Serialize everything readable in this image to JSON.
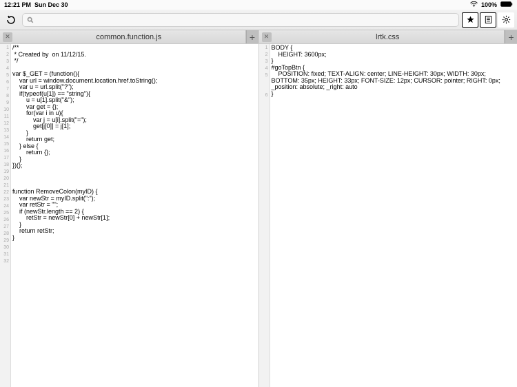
{
  "status": {
    "time": "12:21 PM",
    "date": "Sun Dec 30",
    "battery": "100%"
  },
  "toolbar": {
    "search_placeholder": ""
  },
  "panes": [
    {
      "tab_title": "common.function.js",
      "lines": [
        "/**",
        " * Created by  on 11/12/15.",
        " */",
        "",
        "var $_GET = (function(){",
        "    var url = window.document.location.href.toString();",
        "    var u = url.split(\"?\");",
        "    if(typeof(u[1]) == \"string\"){",
        "        u = u[1].split(\"&\");",
        "        var get = {};",
        "        for(var i in u){",
        "            var j = u[i].split(\"=\");",
        "            get[j[0]] = j[1];",
        "        }",
        "        return get;",
        "    } else {",
        "        return {};",
        "    }",
        "})();",
        "",
        "",
        "",
        "function RemoveColon(myID) {",
        "    var newStr = myID.split(\":\");",
        "    var retStr = \"\";",
        "    if (newStr.length == 2) {",
        "        retStr = newStr[0] + newStr[1];",
        "    }",
        "    return retStr;",
        "}",
        "",
        ""
      ]
    },
    {
      "tab_title": "lrtk.css",
      "lines": [
        "BODY {",
        "    HEIGHT: 3600px;",
        "}",
        "#goTopBtn {",
        "    POSITION: fixed; TEXT-ALIGN: center; LINE-HEIGHT: 30px; WIDTH: 30px; BOTTOM: 35px; HEIGHT: 33px; FONT-SIZE: 12px; CURSOR: pointer; RIGHT: 0px; _position: absolute; _right: auto",
        "}"
      ]
    }
  ]
}
